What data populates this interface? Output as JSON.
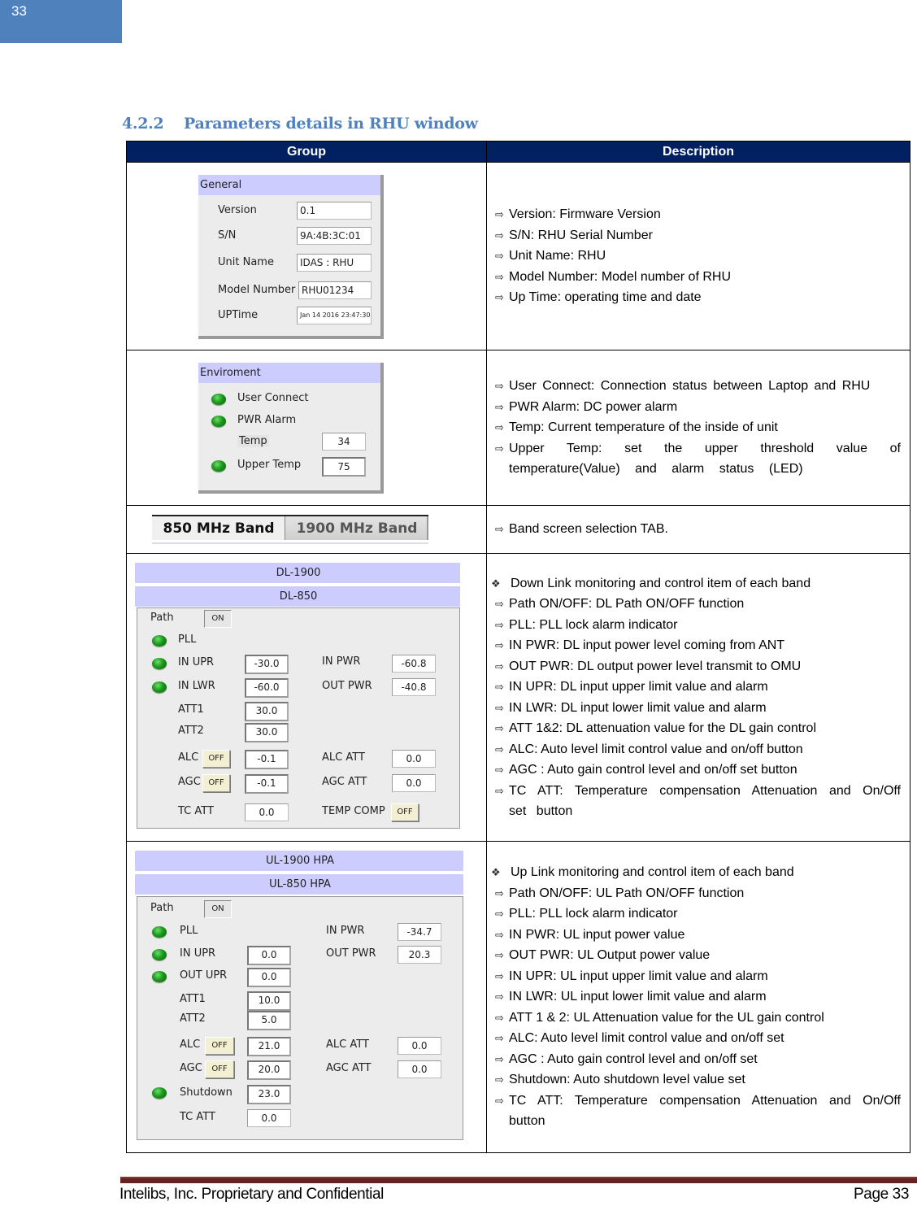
{
  "page_number_tab": "33",
  "section": {
    "number": "4.2.2",
    "title": "Parameters details in RHU window"
  },
  "table": {
    "headers": [
      "Group",
      "Description"
    ],
    "rows": {
      "general": {
        "panel": {
          "title": "General",
          "fields": [
            {
              "label": "Version",
              "value": "0.1"
            },
            {
              "label": "S/N",
              "value": "9A:4B:3C:01"
            },
            {
              "label": "Unit Name",
              "value": "IDAS : RHU"
            },
            {
              "label": "Model Number",
              "value": "RHU01234"
            },
            {
              "label": "UPTime",
              "value": "Jan 14 2016 23:47:30"
            }
          ]
        },
        "desc": [
          "Version: Firmware Version",
          "S/N: RHU Serial Number",
          "Unit Name: RHU",
          "Model Number: Model number of RHU",
          "Up Time: operating time and date"
        ]
      },
      "environment": {
        "panel": {
          "title": "Enviroment",
          "user_connect": "User Connect",
          "pwr_alarm": "PWR Alarm",
          "temp_label": "Temp",
          "temp_value": "34",
          "upper_temp_label": "Upper Temp",
          "upper_temp_value": "75"
        },
        "desc": [
          "User Connect: Connection status between Laptop and RHU",
          "PWR Alarm: DC power alarm",
          "Temp: Current temperature of the inside of unit",
          "Upper Temp: set the upper threshold value of temperature(Value) and alarm status (LED)"
        ]
      },
      "band": {
        "tabs": [
          "850 MHz Band",
          "1900 MHz Band"
        ],
        "desc": [
          "Band screen selection TAB."
        ]
      },
      "downlink": {
        "panel": {
          "tab_back": "DL-1900",
          "tab_front": "DL-850",
          "path_label": "Path",
          "path_state": "ON",
          "pll": "PLL",
          "in_upr_label": "IN UPR",
          "in_upr": "-30.0",
          "in_lwr_label": "IN LWR",
          "in_lwr": "-60.0",
          "in_pwr_label": "IN PWR",
          "in_pwr": "-60.8",
          "out_pwr_label": "OUT PWR",
          "out_pwr": "-40.8",
          "att1_label": "ATT1",
          "att1": "30.0",
          "att2_label": "ATT2",
          "att2": "30.0",
          "alc_label": "ALC",
          "alc_state": "OFF",
          "alc": "-0.1",
          "agc_label": "AGC",
          "agc_state": "OFF",
          "agc": "-0.1",
          "alc_att_label": "ALC ATT",
          "alc_att": "0.0",
          "agc_att_label": "AGC ATT",
          "agc_att": "0.0",
          "tc_att_label": "TC ATT",
          "tc_att": "0.0",
          "temp_comp_label": "TEMP COMP",
          "temp_comp_state": "OFF"
        },
        "heading": "Down Link monitoring and control item of each band",
        "desc": [
          "Path ON/OFF: DL Path ON/OFF function",
          "PLL: PLL lock alarm indicator",
          "IN PWR: DL input power level coming from ANT",
          "OUT PWR: DL output power level transmit to OMU",
          "IN UPR: DL input upper limit value and alarm",
          "IN LWR: DL input lower limit value and alarm",
          "ATT 1&2: DL attenuation value for the DL gain control",
          "ALC: Auto level limit control value and on/off button",
          "AGC : Auto gain control level and on/off set button",
          "TC ATT: Temperature compensation Attenuation and On/Off set button"
        ]
      },
      "uplink": {
        "panel": {
          "tab_back": "UL-1900 HPA",
          "tab_front": "UL-850 HPA",
          "path_label": "Path",
          "path_state": "ON",
          "pll": "PLL",
          "in_upr_label": "IN UPR",
          "in_upr": "0.0",
          "out_upr_label": "OUT UPR",
          "out_upr": "0.0",
          "in_pwr_label": "IN PWR",
          "in_pwr": "-34.7",
          "out_pwr_label": "OUT PWR",
          "out_pwr": "20.3",
          "att1_label": "ATT1",
          "att1": "10.0",
          "att2_label": "ATT2",
          "att2": "5.0",
          "alc_label": "ALC",
          "alc_state": "OFF",
          "alc": "21.0",
          "agc_label": "AGC",
          "agc_state": "OFF",
          "agc": "20.0",
          "alc_att_label": "ALC ATT",
          "alc_att": "0.0",
          "agc_att_label": "AGC ATT",
          "agc_att": "0.0",
          "shutdown_label": "Shutdown",
          "shutdown": "23.0",
          "tc_att_label": "TC ATT",
          "tc_att": "0.0"
        },
        "heading": "Up Link monitoring and control item of each band",
        "desc": [
          "Path ON/OFF: UL Path ON/OFF function",
          "PLL: PLL lock alarm indicator",
          "IN PWR: UL input power value",
          "OUT PWR: UL Output power value",
          "IN UPR: UL input upper limit value and alarm",
          "IN LWR: UL input lower limit value and alarm",
          "ATT 1 & 2: UL Attenuation value for the UL gain control",
          "ALC: Auto level limit control value and on/off set",
          "AGC : Auto gain control  level and on/off set",
          "Shutdown: Auto shutdown level value set",
          "TC ATT: Temperature compensation Attenuation and On/Off button"
        ]
      }
    }
  },
  "icons": {
    "bullet_arrow": "⇨",
    "bullet_diamond": "❖"
  },
  "footer": {
    "left": "Intelibs, Inc. Proprietary and Confidential",
    "right": "Page 33"
  },
  "colors": {
    "page_tab": "#4f81bd",
    "section_title": "#4f81bd",
    "table_header": "#002060",
    "footer_bar": "#632523",
    "panel_header": "#ccccff",
    "led": "#1a9a1a"
  }
}
